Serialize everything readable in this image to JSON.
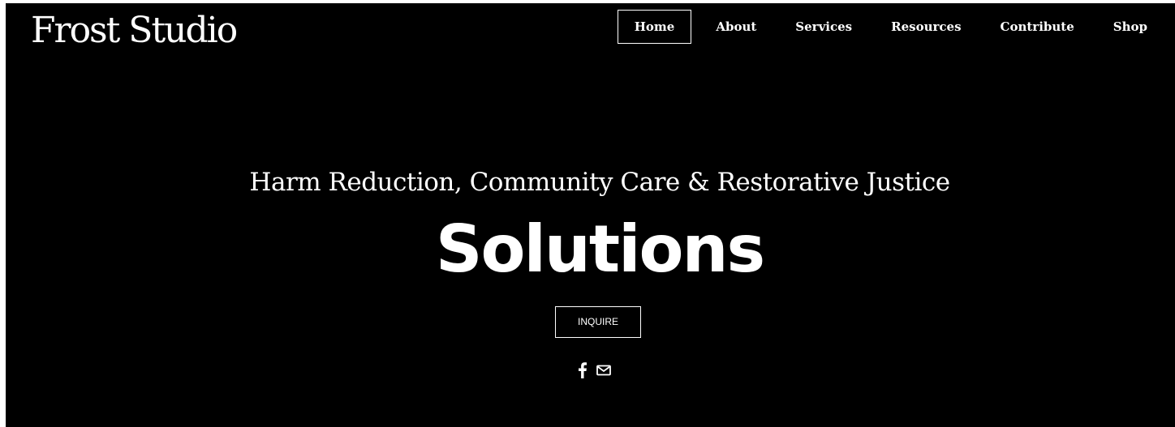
{
  "brand": {
    "name": "Frost Studio"
  },
  "nav": {
    "items": [
      {
        "label": "Home",
        "active": true
      },
      {
        "label": "About"
      },
      {
        "label": "Services"
      },
      {
        "label": "Resources"
      },
      {
        "label": "Contribute"
      },
      {
        "label": "Shop"
      }
    ]
  },
  "hero": {
    "tagline": "Harm Reduction, Community Care & Restorative Justice",
    "headline": "Solutions",
    "cta_label": "INQUIRE"
  },
  "social": {
    "icons": [
      "facebook-icon",
      "email-icon"
    ]
  },
  "colors": {
    "background": "#000000",
    "text": "#ffffff"
  }
}
